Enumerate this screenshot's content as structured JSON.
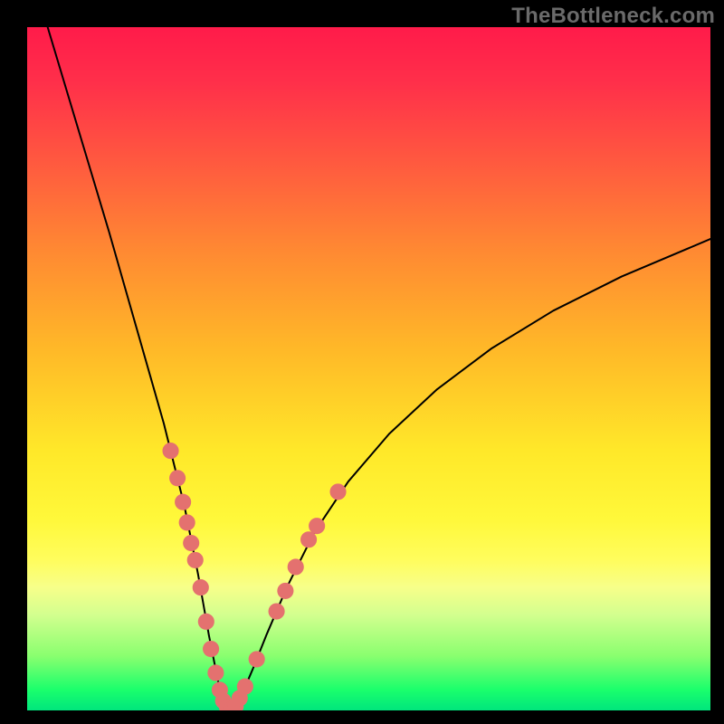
{
  "watermark": "TheBottleneck.com",
  "chart_background": {
    "gradient_stops": [
      {
        "pos": 0.0,
        "color": "#ff1b4a"
      },
      {
        "pos": 0.08,
        "color": "#ff2f4a"
      },
      {
        "pos": 0.2,
        "color": "#ff5a3f"
      },
      {
        "pos": 0.33,
        "color": "#ff8a32"
      },
      {
        "pos": 0.47,
        "color": "#ffb828"
      },
      {
        "pos": 0.62,
        "color": "#ffe829"
      },
      {
        "pos": 0.72,
        "color": "#fff83a"
      },
      {
        "pos": 0.78,
        "color": "#fffd5d"
      },
      {
        "pos": 0.82,
        "color": "#f7ff8a"
      },
      {
        "pos": 0.86,
        "color": "#d3ff8f"
      },
      {
        "pos": 0.92,
        "color": "#8aff6f"
      },
      {
        "pos": 0.97,
        "color": "#1aff6c"
      },
      {
        "pos": 1.0,
        "color": "#00e57d"
      }
    ]
  },
  "chart_data": {
    "type": "line",
    "title": "",
    "xlabel": "",
    "ylabel": "",
    "xlim": [
      0,
      100
    ],
    "ylim": [
      0,
      100
    ],
    "grid": false,
    "series": [
      {
        "name": "curve",
        "x": [
          3,
          6,
          9,
          12,
          14,
          16,
          18,
          20,
          21.5,
          23,
          24,
          25,
          25.8,
          26.6,
          27.4,
          28,
          28.6,
          29.2,
          29.8,
          30.5,
          31.5,
          33,
          35,
          38,
          42,
          47,
          53,
          60,
          68,
          77,
          87,
          100
        ],
        "y": [
          100,
          90,
          80,
          70,
          63,
          56,
          49,
          42,
          36,
          30,
          25,
          20,
          15.5,
          11,
          7,
          4,
          2,
          0.8,
          0.2,
          0.6,
          2.5,
          6,
          11,
          18,
          26,
          33.5,
          40.5,
          47,
          53,
          58.5,
          63.5,
          69
        ],
        "stroke": "#000000",
        "stroke_width": 2
      }
    ],
    "markers": {
      "name": "dots",
      "color": "#e4716f",
      "radius_pct": 1.2,
      "points": [
        {
          "x": 21.0,
          "y": 38.0
        },
        {
          "x": 22.0,
          "y": 34.0
        },
        {
          "x": 22.8,
          "y": 30.5
        },
        {
          "x": 23.4,
          "y": 27.5
        },
        {
          "x": 24.0,
          "y": 24.5
        },
        {
          "x": 24.6,
          "y": 22.0
        },
        {
          "x": 25.4,
          "y": 18.0
        },
        {
          "x": 26.2,
          "y": 13.0
        },
        {
          "x": 26.9,
          "y": 9.0
        },
        {
          "x": 27.6,
          "y": 5.5
        },
        {
          "x": 28.2,
          "y": 3.0
        },
        {
          "x": 28.7,
          "y": 1.4
        },
        {
          "x": 29.3,
          "y": 0.4
        },
        {
          "x": 29.9,
          "y": 0.2
        },
        {
          "x": 30.5,
          "y": 0.6
        },
        {
          "x": 31.1,
          "y": 1.8
        },
        {
          "x": 31.9,
          "y": 3.5
        },
        {
          "x": 33.6,
          "y": 7.5
        },
        {
          "x": 36.5,
          "y": 14.5
        },
        {
          "x": 37.8,
          "y": 17.5
        },
        {
          "x": 39.3,
          "y": 21.0
        },
        {
          "x": 41.2,
          "y": 25.0
        },
        {
          "x": 42.4,
          "y": 27.0
        },
        {
          "x": 45.5,
          "y": 32.0
        }
      ]
    }
  }
}
